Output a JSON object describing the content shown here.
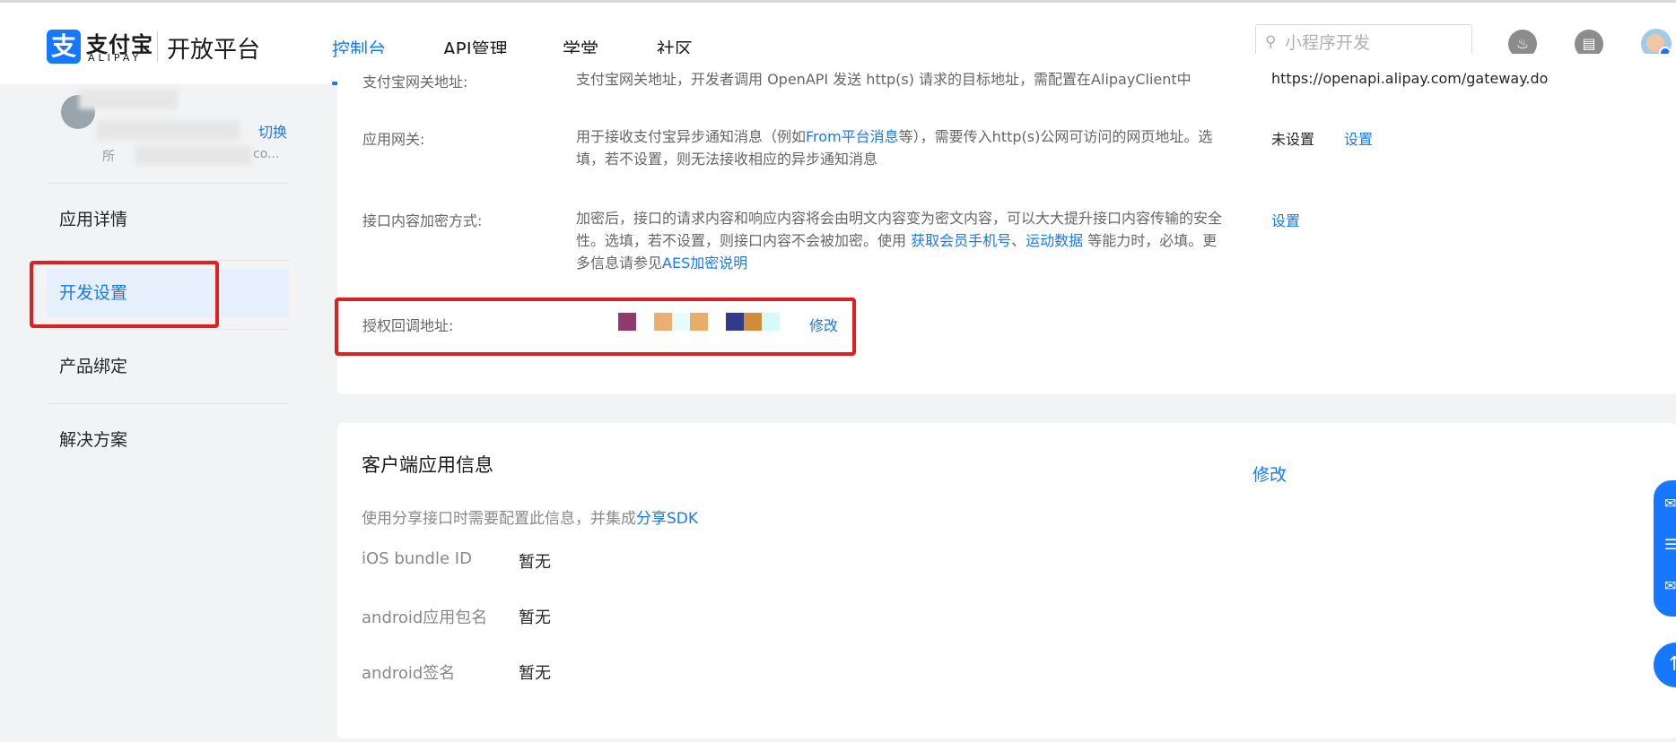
{
  "header": {
    "logo_char": "支",
    "logo_cn": "支付宝",
    "logo_en": "ALIPAY",
    "platform": "开放平台",
    "nav": [
      "控制台",
      "API管理",
      "学堂",
      "社区"
    ],
    "search_placeholder": "小程序开发"
  },
  "sidebar": {
    "switch_label": "切换",
    "app_name_fragment": "所",
    "app_id_fragment": "co...",
    "items": [
      "应用详情",
      "开发设置",
      "产品绑定",
      "解决方案"
    ],
    "active_item": "开发设置"
  },
  "dev_settings": {
    "gateway_label": "支付宝网关地址:",
    "gateway_desc": "支付宝网关地址，开发者调用 OpenAPI 发送 http(s) 请求的目标地址，需配置在AlipayClient中",
    "gateway_value": "https://openapi.alipay.com/gateway.do",
    "app_gateway_label": "应用网关:",
    "app_gateway_desc_1": "用于接收支付宝异步通知消息（例如",
    "app_gateway_desc_link": "From平台消息",
    "app_gateway_desc_2": "等），需要传入http(s)公网可访问的网页地址。选填，若不设置，则无法接收相应的异步通知消息",
    "app_gateway_status": "未设置",
    "app_gateway_action": "设置",
    "encrypt_label": "接口内容加密方式:",
    "encrypt_desc_1": "加密后，接口的请求内容和响应内容将会由明文内容变为密文内容，可以大大提升接口内容传输的安全性。选填，若不设置，则接口内容不会被加密。使用 ",
    "encrypt_desc_link1": "获取会员手机号",
    "encrypt_desc_sep": "、",
    "encrypt_desc_link2": "运动数据",
    "encrypt_desc_2": " 等能力时，必填。更多信息请参见",
    "encrypt_desc_link3": "AES加密说明",
    "encrypt_action": "设置",
    "callback_label": "授权回调地址:",
    "callback_action": "修改"
  },
  "client_info": {
    "title": "客户端应用信息",
    "edit": "修改",
    "desc": "使用分享接口时需要配置此信息，并集成",
    "desc_link": "分享SDK",
    "rows": [
      {
        "label": "iOS bundle ID",
        "value": "暂无"
      },
      {
        "label": "android应用包名",
        "value": "暂无"
      },
      {
        "label": "android签名",
        "value": "暂无"
      }
    ]
  },
  "colors": {
    "accent": "#1677ff",
    "highlight": "#e02020",
    "active_bg": "#e6f0fd"
  }
}
